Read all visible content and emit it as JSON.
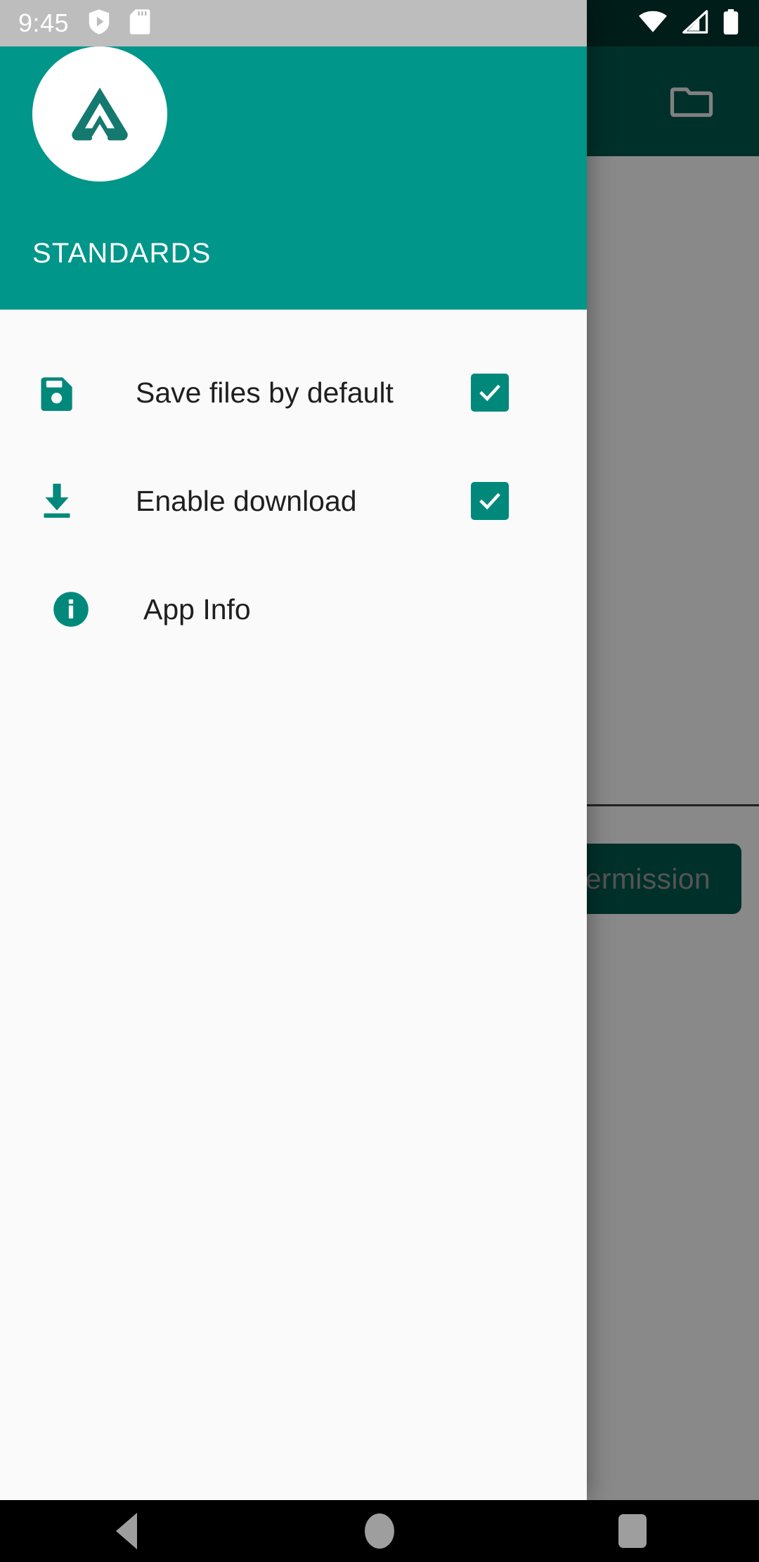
{
  "status_bar": {
    "time": "9:45",
    "left_icons": [
      "play-protect-shield-icon",
      "sd-card-icon"
    ],
    "right_icons": [
      "wifi-icon",
      "cellular-signal-icon",
      "battery-icon"
    ],
    "background_color": "#BDBDBD",
    "app_background_color": "#00352F"
  },
  "drawer": {
    "header": {
      "app_name": "STANDARDS",
      "logo_icon": "standards-triangle-logo",
      "background_color": "#00968A",
      "logo_color": "#00897B"
    },
    "background_color": "#FAFAFA",
    "menu_items": [
      {
        "label": "Save files by default",
        "icon": "save-floppy-icon",
        "has_checkbox": true,
        "checked": true
      },
      {
        "label": "Enable download",
        "icon": "download-icon",
        "has_checkbox": true,
        "checked": true
      },
      {
        "label": "App Info",
        "icon": "info-circle-icon",
        "has_checkbox": false,
        "checked": false
      }
    ],
    "accent_color": "#00897B"
  },
  "background_app": {
    "appbar": {
      "background_color": "#00584D",
      "folder_icon": "folder-icon"
    },
    "grant_permission_button": {
      "label": "Grant permission",
      "background_color": "#00584D"
    },
    "scrim_color": "rgba(0,0,0,0.45)"
  },
  "system_navbar": {
    "background_color": "#000000",
    "buttons": [
      {
        "name": "back",
        "icon": "triangle-back-icon"
      },
      {
        "name": "home",
        "icon": "circle-home-icon"
      },
      {
        "name": "recents",
        "icon": "square-recents-icon"
      }
    ]
  }
}
